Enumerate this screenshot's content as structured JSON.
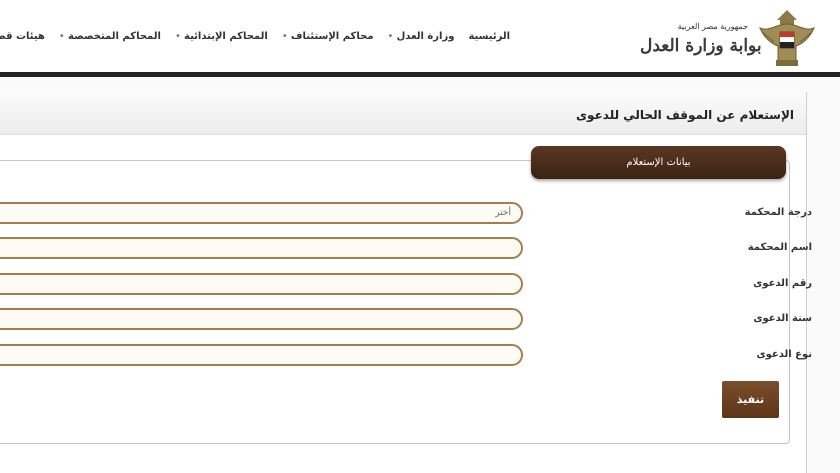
{
  "header": {
    "logo_top": "جمهورية مصر العربية",
    "logo_main": "بوابة وزارة العدل",
    "nav": [
      "الرئيسية",
      "وزارة العدل",
      "محاكم الإستئناف",
      "المحاكم الإبتدائية",
      "المحاكم المتخصصة",
      "هيئات قضائية"
    ]
  },
  "panel": {
    "title": "الإستعلام عن الموقف الحالي للدعوى",
    "legend": "بيانات الإستعلام"
  },
  "form": {
    "fields": [
      {
        "label": "درجة المحكمة",
        "value": "أختر"
      },
      {
        "label": "اسم المحكمة",
        "value": ""
      },
      {
        "label": "رقم الدعوى",
        "value": ""
      },
      {
        "label": "سنة الدعوى",
        "value": ""
      },
      {
        "label": "نوع الدعوى",
        "value": ""
      }
    ],
    "submit_label": "تنفيذ"
  },
  "colors": {
    "header_bar": "#242424",
    "legend_brown": "#4a2d18",
    "input_border": "#a47e4f",
    "button_brown": "#6b4122"
  },
  "icons": {
    "logo": "egyptian-eagle-emblem-icon"
  }
}
